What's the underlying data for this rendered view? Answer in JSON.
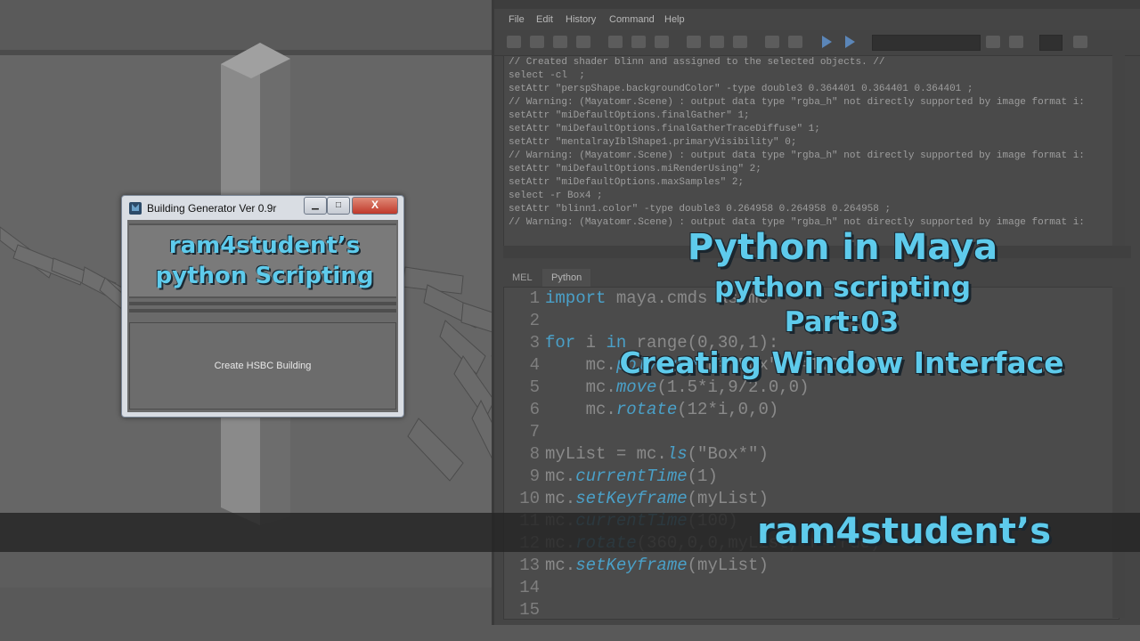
{
  "script_editor": {
    "menu": [
      "File",
      "Edit",
      "History",
      "Command",
      "Help"
    ],
    "history_lines": [
      "// Created shader blinn and assigned to the selected objects. //",
      "select -cl  ;",
      "setAttr \"perspShape.backgroundColor\" -type double3 0.364401 0.364401 0.364401 ;",
      "// Warning: (Mayatomr.Scene) : output data type \"rgba_h\" not directly supported by image format i:",
      "setAttr \"miDefaultOptions.finalGather\" 1;",
      "setAttr \"miDefaultOptions.finalGatherTraceDiffuse\" 1;",
      "setAttr \"mentalrayIblShape1.primaryVisibility\" 0;",
      "// Warning: (Mayatomr.Scene) : output data type \"rgba_h\" not directly supported by image format i:",
      "setAttr \"miDefaultOptions.miRenderUsing\" 2;",
      "setAttr \"miDefaultOptions.maxSamples\" 2;",
      "select -r Box4 ;",
      "setAttr \"blinn1.color\" -type double3 0.264958 0.264958 0.264958 ;",
      "// Warning: (Mayatomr.Scene) : output data type \"rgba_h\" not directly supported by image format i:"
    ],
    "tabs": [
      "MEL",
      "Python"
    ],
    "code_lines": [
      {
        "n": "1",
        "parts": [
          {
            "t": "import",
            "c": "kw"
          },
          {
            "t": " maya.cmds as mc",
            "c": ""
          }
        ]
      },
      {
        "n": "2",
        "parts": []
      },
      {
        "n": "3",
        "parts": [
          {
            "t": "for",
            "c": "kw"
          },
          {
            "t": " i ",
            "c": ""
          },
          {
            "t": "in",
            "c": "kw"
          },
          {
            "t": " range(0,30,1):",
            "c": ""
          }
        ]
      },
      {
        "n": "4",
        "parts": [
          {
            "t": "    mc.",
            "c": ""
          },
          {
            "t": "polyCube",
            "c": "fn"
          },
          {
            "t": "(n=\"Box\",w=1.0,h=1.0",
            "c": ""
          }
        ]
      },
      {
        "n": "5",
        "parts": [
          {
            "t": "    mc.",
            "c": ""
          },
          {
            "t": "move",
            "c": "fn"
          },
          {
            "t": "(1.5*i,9/2.0,0)",
            "c": ""
          }
        ]
      },
      {
        "n": "6",
        "parts": [
          {
            "t": "    mc.",
            "c": ""
          },
          {
            "t": "rotate",
            "c": "fn"
          },
          {
            "t": "(12*i,0,0)",
            "c": ""
          }
        ]
      },
      {
        "n": "7",
        "parts": []
      },
      {
        "n": "8",
        "parts": [
          {
            "t": "myList = mc.",
            "c": ""
          },
          {
            "t": "ls",
            "c": "fn"
          },
          {
            "t": "(\"Box*\")",
            "c": ""
          }
        ]
      },
      {
        "n": "9",
        "parts": [
          {
            "t": "mc.",
            "c": ""
          },
          {
            "t": "currentTime",
            "c": "fn"
          },
          {
            "t": "(1)",
            "c": ""
          }
        ]
      },
      {
        "n": "10",
        "parts": [
          {
            "t": "mc.",
            "c": ""
          },
          {
            "t": "setKeyframe",
            "c": "fn"
          },
          {
            "t": "(myList)",
            "c": ""
          }
        ]
      },
      {
        "n": "11",
        "parts": [
          {
            "t": "mc.",
            "c": ""
          },
          {
            "t": "currentTime",
            "c": "fn"
          },
          {
            "t": "(100)",
            "c": ""
          }
        ]
      },
      {
        "n": "12",
        "parts": [
          {
            "t": "mc.",
            "c": ""
          },
          {
            "t": "rotate",
            "c": "fn"
          },
          {
            "t": "(360,0,0,myList, r=True)",
            "c": ""
          }
        ]
      },
      {
        "n": "13",
        "parts": [
          {
            "t": "mc.",
            "c": ""
          },
          {
            "t": "setKeyframe",
            "c": "fn"
          },
          {
            "t": "(myList)",
            "c": ""
          }
        ]
      },
      {
        "n": "14",
        "parts": []
      },
      {
        "n": "15",
        "parts": []
      }
    ]
  },
  "dialog": {
    "title": "Building Generator Ver 0.9r",
    "banner_line1": "ram4student’s",
    "banner_line2": "python Scripting",
    "create_button": "Create HSBC Building",
    "minimize_glyph": "▁",
    "maximize_glyph": "□",
    "close_glyph": "X"
  },
  "overlay": {
    "title": "Python in Maya",
    "subtitle": "python scripting",
    "part": "Part:03",
    "topic": "Creating Window Interface",
    "brand": "ram4student’s"
  },
  "colors": {
    "accent": "#5ecbec",
    "keyword": "#4aa0c8"
  }
}
